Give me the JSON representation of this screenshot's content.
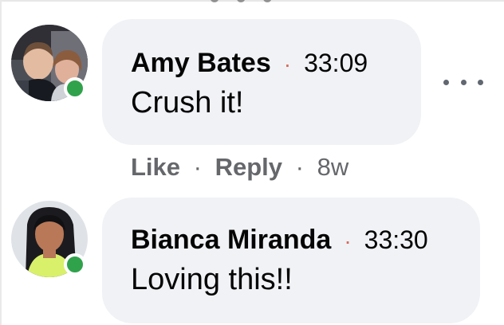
{
  "comments": [
    {
      "author": "Amy Bates",
      "separator": "·",
      "time_label": "33:09",
      "text": "Crush it!",
      "actions": {
        "like": "Like",
        "reply": "Reply",
        "dot": "·",
        "age": "8w"
      },
      "online": true
    },
    {
      "author": "Bianca Miranda",
      "separator": "·",
      "time_label": "33:30",
      "text": "Loving this!!",
      "online": true
    }
  ],
  "icons": {
    "more": "more-options-icon",
    "status": "online-status-icon"
  },
  "colors": {
    "bubble": "#f0f2f5",
    "online": "#31a24c",
    "meta": "#65676b",
    "text": "#050505"
  }
}
